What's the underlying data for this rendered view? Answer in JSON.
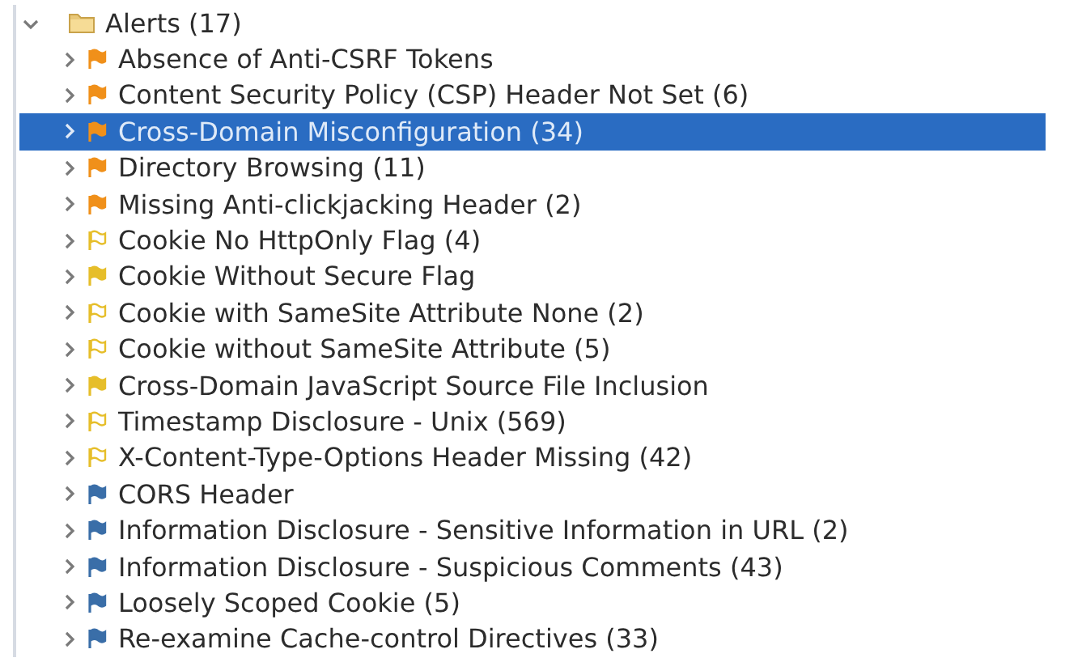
{
  "tree": {
    "label": "Alerts (17)",
    "expanded": true,
    "children": [
      {
        "label": "Absence of Anti-CSRF Tokens",
        "color": "#f0901a",
        "kind": "solid",
        "expanded": false,
        "selected": false
      },
      {
        "label": "Content Security Policy (CSP) Header Not Set (6)",
        "color": "#f0901a",
        "kind": "solid",
        "expanded": false,
        "selected": false
      },
      {
        "label": "Cross-Domain Misconfiguration (34)",
        "color": "#f0901a",
        "kind": "solid",
        "expanded": false,
        "selected": true
      },
      {
        "label": "Directory Browsing (11)",
        "color": "#f0901a",
        "kind": "solid",
        "expanded": false,
        "selected": false
      },
      {
        "label": "Missing Anti-clickjacking Header (2)",
        "color": "#f0901a",
        "kind": "solid",
        "expanded": false,
        "selected": false
      },
      {
        "label": "Cookie No HttpOnly Flag (4)",
        "color": "#e6be2a",
        "kind": "hollow",
        "expanded": false,
        "selected": false
      },
      {
        "label": "Cookie Without Secure Flag",
        "color": "#e6be2a",
        "kind": "solid",
        "expanded": false,
        "selected": false
      },
      {
        "label": "Cookie with SameSite Attribute None (2)",
        "color": "#e6be2a",
        "kind": "hollow",
        "expanded": false,
        "selected": false
      },
      {
        "label": "Cookie without SameSite Attribute (5)",
        "color": "#e6be2a",
        "kind": "hollow",
        "expanded": false,
        "selected": false
      },
      {
        "label": "Cross-Domain JavaScript Source File Inclusion",
        "color": "#e6be2a",
        "kind": "solid",
        "expanded": false,
        "selected": false
      },
      {
        "label": "Timestamp Disclosure - Unix (569)",
        "color": "#e6be2a",
        "kind": "hollow",
        "expanded": false,
        "selected": false
      },
      {
        "label": "X-Content-Type-Options Header Missing (42)",
        "color": "#e6be2a",
        "kind": "hollow",
        "expanded": false,
        "selected": false
      },
      {
        "label": "CORS Header",
        "color": "#3a6ea8",
        "kind": "solid",
        "expanded": false,
        "selected": false
      },
      {
        "label": "Information Disclosure - Sensitive Information in URL (2)",
        "color": "#3a6ea8",
        "kind": "solid",
        "expanded": false,
        "selected": false
      },
      {
        "label": "Information Disclosure - Suspicious Comments (43)",
        "color": "#3a6ea8",
        "kind": "solid",
        "expanded": false,
        "selected": false
      },
      {
        "label": "Loosely Scoped Cookie (5)",
        "color": "#3a6ea8",
        "kind": "solid",
        "expanded": false,
        "selected": false
      },
      {
        "label": "Re-examine Cache-control Directives (33)",
        "color": "#3a6ea8",
        "kind": "solid",
        "expanded": false,
        "selected": false
      }
    ]
  }
}
